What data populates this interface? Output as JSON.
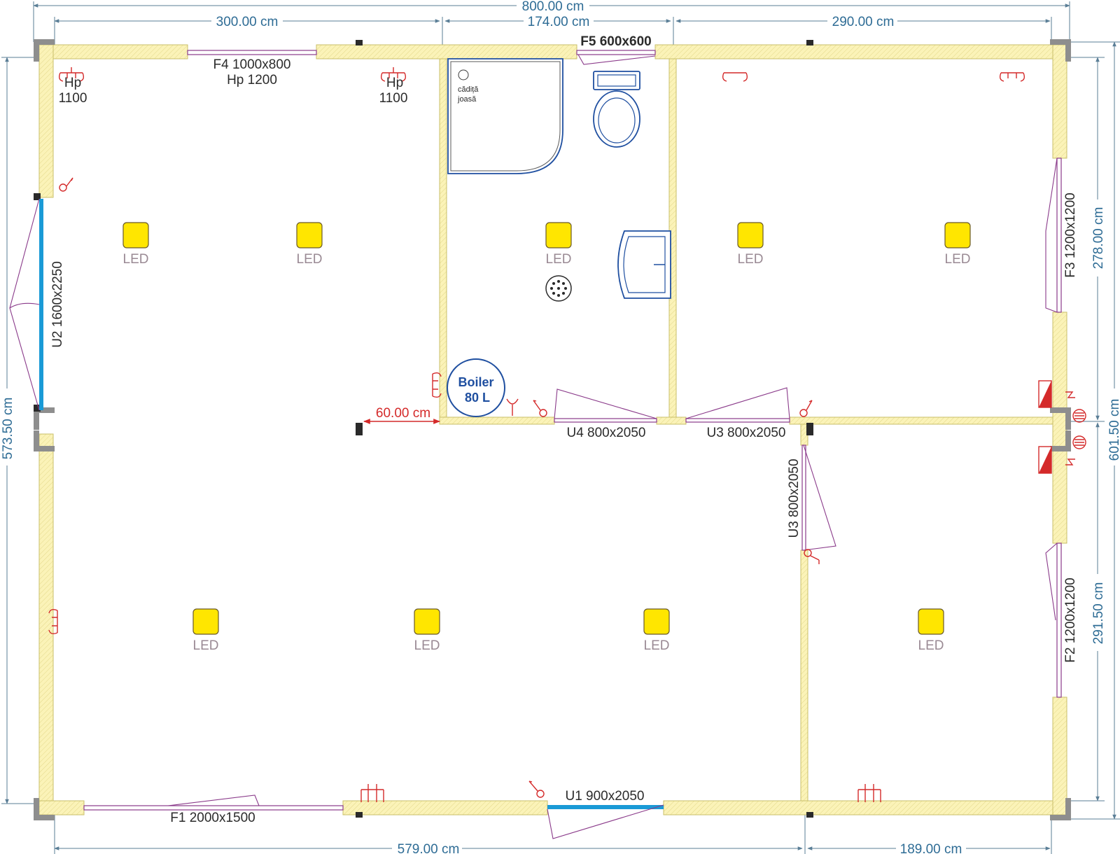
{
  "plan": {
    "overall_width": "800.00 cm",
    "dims_top": [
      "300.00 cm",
      "174.00 cm",
      "290.00 cm"
    ],
    "dims_bottom": [
      "579.00 cm",
      "189.00 cm"
    ],
    "dim_left": "573.50 cm",
    "dim_right_outer": "601.50 cm",
    "dims_right_inner": [
      "278.00 cm",
      "291.50 cm"
    ],
    "offset": "60.00 cm",
    "windows": {
      "f1": "F1 2000x1500",
      "f2": "F2 1200x1200",
      "f3": "F3 1200x1200",
      "f4_line1": "F4 1000x800",
      "f4_line2": "Hp 1200",
      "f5": "F5 600x600"
    },
    "doors": {
      "u1": "U1 900x2050",
      "u2": "U2 1600x2250",
      "u3_a": "U3 800x2050",
      "u3_b": "U3 800x2050",
      "u4": "U4 800x2050"
    },
    "heights": [
      {
        "hp": "Hp",
        "value": "1100"
      },
      {
        "hp": "Hp",
        "value": "1100"
      }
    ],
    "shower_note": [
      "cădiță",
      "joasă"
    ],
    "boiler": [
      "Boiler",
      "80 L"
    ],
    "led_label": "LED",
    "colors": {
      "wall_fill": "#fbf3b8",
      "led_fill": "#ffe600",
      "dimension": "#2e6c95",
      "fixture": "#1f4fa0",
      "door_window": "#8a3a8a",
      "electric": "#d42a2a",
      "door_leaf_blue": "#1a9ad6"
    }
  }
}
